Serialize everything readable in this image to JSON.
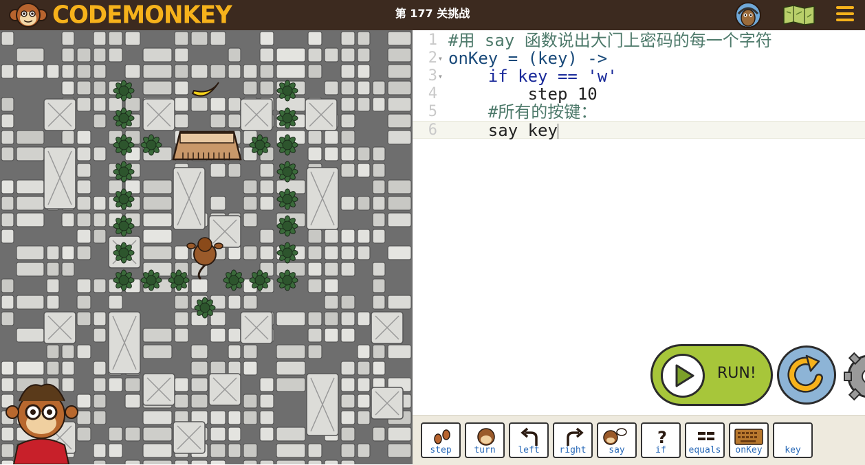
{
  "header": {
    "logo_text": "CODEMONKEY",
    "level_title": "第 177 关挑战",
    "icons": [
      "monkey-face-logo-icon",
      "avatar-icon",
      "map-icon",
      "menu-icon"
    ],
    "accent_color": "#f6b21b",
    "background_color": "#3c2a1f"
  },
  "editor": {
    "lines": [
      {
        "num": "1",
        "text": "#用 say 函数说出大门上密码的每一个字符"
      },
      {
        "num": "2",
        "text": "onKey = (key) ->"
      },
      {
        "num": "3",
        "text": "    if key == 'w'"
      },
      {
        "num": "4",
        "text": "        step 10"
      },
      {
        "num": "5",
        "text": "    #所有的按键："
      },
      {
        "num": "6",
        "text": "    say key"
      }
    ]
  },
  "palette": {
    "buttons": [
      {
        "label": "step",
        "icon": "footprints-icon"
      },
      {
        "label": "turn",
        "icon": "monkey-head-icon"
      },
      {
        "label": "left",
        "icon": "arrow-left-curve-icon"
      },
      {
        "label": "right",
        "icon": "arrow-right-curve-icon"
      },
      {
        "label": "say",
        "icon": "speech-bubble-icon"
      },
      {
        "label": "if",
        "icon": "question-mark-icon"
      },
      {
        "label": "equals",
        "icon": "equals-icon"
      },
      {
        "label": "onKey",
        "icon": "keyboard-icon"
      },
      {
        "label": "key",
        "icon": ""
      }
    ]
  },
  "controls": {
    "run_label": "RUN!",
    "run_color": "#a7c63a",
    "reset_color": "#8db4d6"
  }
}
